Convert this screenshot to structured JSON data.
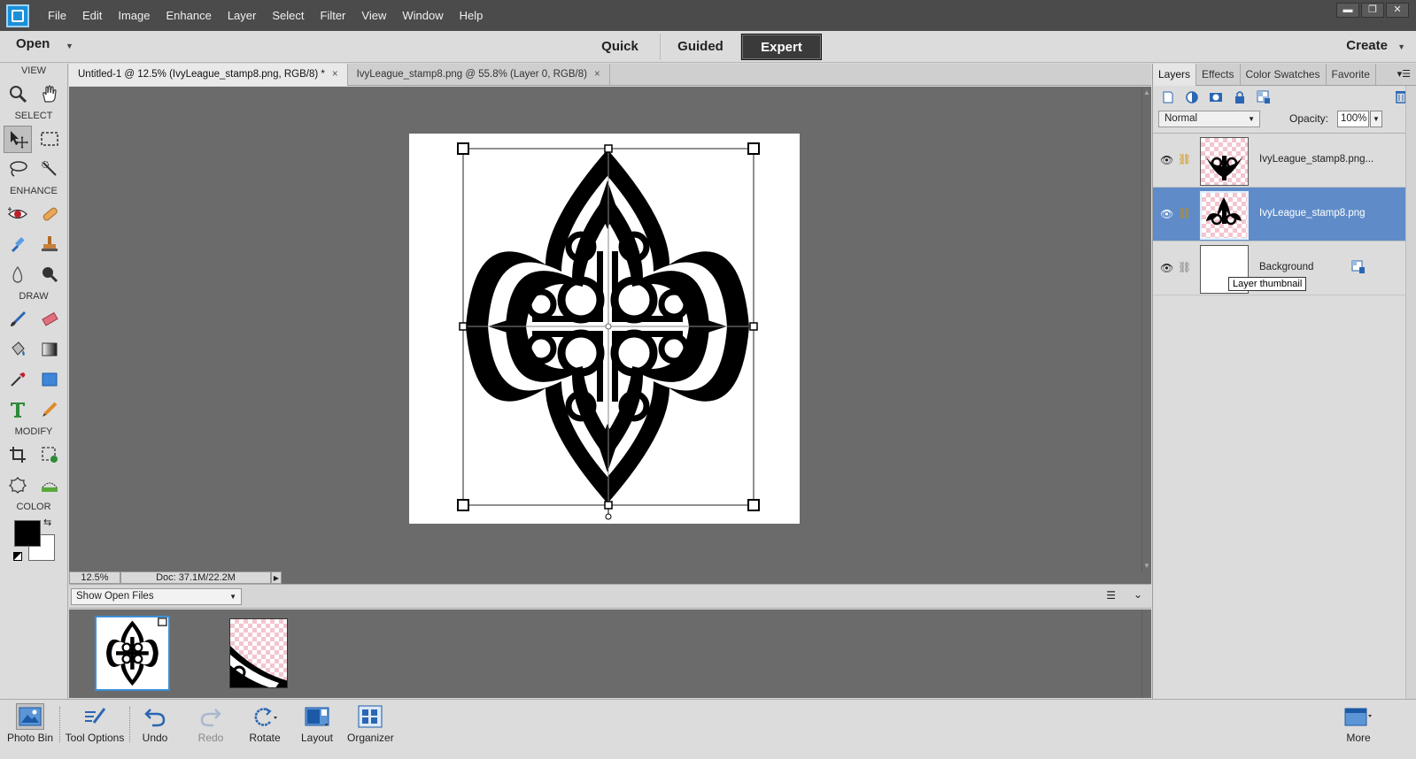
{
  "menu": [
    "File",
    "Edit",
    "Image",
    "Enhance",
    "Layer",
    "Select",
    "Filter",
    "View",
    "Window",
    "Help"
  ],
  "window_controls": [
    "▬",
    "❐",
    "✕"
  ],
  "modebar": {
    "open_label": "Open",
    "modes": [
      "Quick",
      "Guided",
      "Expert"
    ],
    "active_mode": "Expert",
    "create_label": "Create"
  },
  "toolbox": {
    "sections": {
      "view": "VIEW",
      "select": "SELECT",
      "enhance": "ENHANCE",
      "draw": "DRAW",
      "modify": "MODIFY",
      "color": "COLOR"
    },
    "foreground_color": "#000000",
    "background_color": "#ffffff"
  },
  "document_tabs": [
    {
      "label": "Untitled-1 @ 12.5% (IvyLeague_stamp8.png, RGB/8) *",
      "close": "×"
    },
    {
      "label": "IvyLeague_stamp8.png @ 55.8% (Layer 0, RGB/8)",
      "close": "×"
    }
  ],
  "status": {
    "zoom": "12.5%",
    "doc_info": "Doc: 37.1M/22.2M"
  },
  "photo_bin": {
    "select_value": "Show Open Files"
  },
  "panel": {
    "tabs": [
      "Layers",
      "Effects",
      "Color Swatches",
      "Favorite"
    ],
    "active_tab": "Layers",
    "blend_mode": "Normal",
    "opacity_label": "Opacity:",
    "opacity_value": "100%",
    "layers": [
      {
        "name": "IvyLeague_stamp8.png...",
        "selected": false
      },
      {
        "name": "IvyLeague_stamp8.png",
        "selected": true
      },
      {
        "name": "Background",
        "selected": false
      }
    ],
    "tooltip": "Layer thumbnail"
  },
  "taskbar": {
    "photo_bin": "Photo Bin",
    "tool_options": "Tool Options",
    "undo": "Undo",
    "redo": "Redo",
    "rotate": "Rotate",
    "layout": "Layout",
    "organizer": "Organizer",
    "more": "More"
  },
  "colors": {
    "selection_blue": "#5f8cc9",
    "canvas_grey": "#6b6b6b",
    "accent": "#2a66b3"
  }
}
